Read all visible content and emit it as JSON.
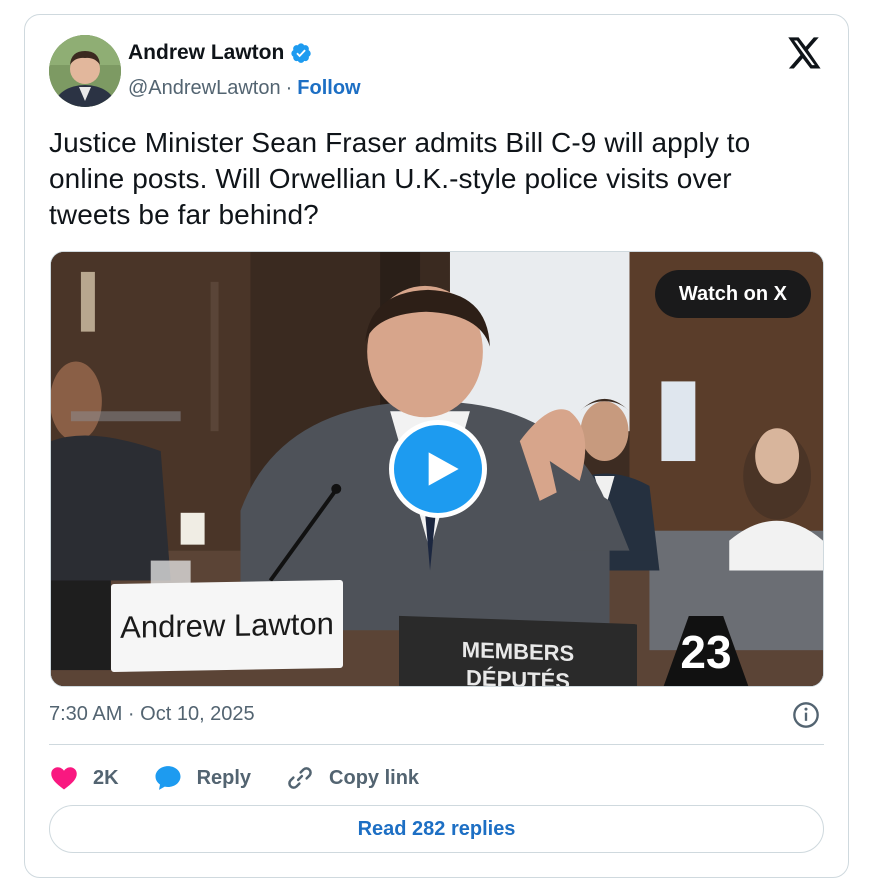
{
  "author": {
    "name": "Andrew Lawton",
    "handle": "@AndrewLawton",
    "separator": "·",
    "follow_label": "Follow",
    "verified": true,
    "verified_color": "#1d9bf0"
  },
  "tweet": {
    "text": "Justice Minister Sean Fraser admits Bill C-9 will apply to online posts. Will Orwellian U.K.-style police visits over tweets be far behind?"
  },
  "media": {
    "watch_label": "Watch on X",
    "nameplate": "Andrew Lawton",
    "members_line1": "MEMBERS",
    "members_line2": "DÉPUTÉS",
    "seat_number": "23"
  },
  "timestamp": "7:30 AM · Oct 10, 2025",
  "actions": {
    "likes_count": "2K",
    "reply_label": "Reply",
    "copy_link_label": "Copy link"
  },
  "read_replies_label": "Read 282 replies",
  "colors": {
    "accent": "#1d6fc4",
    "like": "#f91880",
    "reply_icon": "#1d9bf0",
    "muted": "#536471"
  },
  "icons": [
    "x-logo-icon",
    "verified-badge-icon",
    "play-icon",
    "info-icon",
    "heart-icon",
    "reply-bubble-icon",
    "link-icon"
  ]
}
